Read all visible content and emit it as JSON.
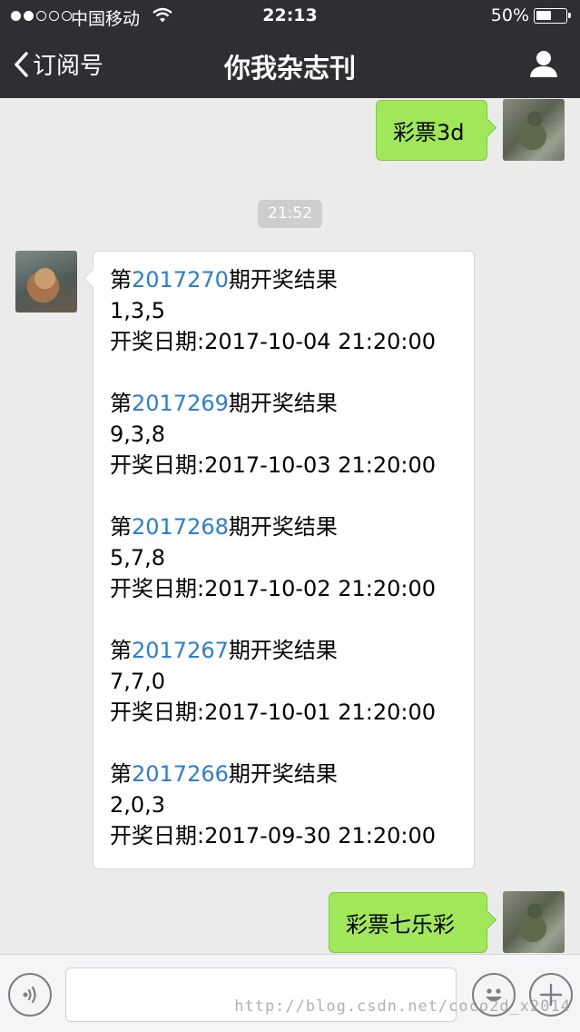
{
  "status_bar": {
    "carrier": "中国移动",
    "time": "22:13",
    "battery": "50%",
    "battery_level": 0.5
  },
  "nav": {
    "back_label": "订阅号",
    "title": "你我杂志刊"
  },
  "messages": {
    "sent_first": "彩票3d",
    "timestamp": "21:52",
    "sent_last": "彩票七乐彩"
  },
  "results": [
    {
      "prefix": "第",
      "issue": "2017270",
      "suffix": "期开奖结果",
      "numbers": "1,3,5",
      "date": "开奖日期:2017-10-04 21:20:00"
    },
    {
      "prefix": "第",
      "issue": "2017269",
      "suffix": "期开奖结果",
      "numbers": "9,3,8",
      "date": "开奖日期:2017-10-03 21:20:00"
    },
    {
      "prefix": "第",
      "issue": "2017268",
      "suffix": "期开奖结果",
      "numbers": "5,7,8",
      "date": "开奖日期:2017-10-02 21:20:00"
    },
    {
      "prefix": "第",
      "issue": "2017267",
      "suffix": "期开奖结果",
      "numbers": "7,7,0",
      "date": "开奖日期:2017-10-01 21:20:00"
    },
    {
      "prefix": "第",
      "issue": "2017266",
      "suffix": "期开奖结果",
      "numbers": "2,0,3",
      "date": "开奖日期:2017-09-30 21:20:00"
    }
  ],
  "watermark": "http://blog.csdn.net/coco2d_x2014",
  "colors": {
    "nav_bg": "#2e2e33",
    "chat_bg": "#ebebeb",
    "sent_bubble": "#a0e75a",
    "issue_link": "#2a7ed8"
  },
  "icons": {
    "back": "chevron-left-icon",
    "profile": "person-icon",
    "voice": "voice-icon",
    "emoji": "smiley-icon",
    "more": "plus-icon",
    "wifi": "wifi-icon"
  }
}
